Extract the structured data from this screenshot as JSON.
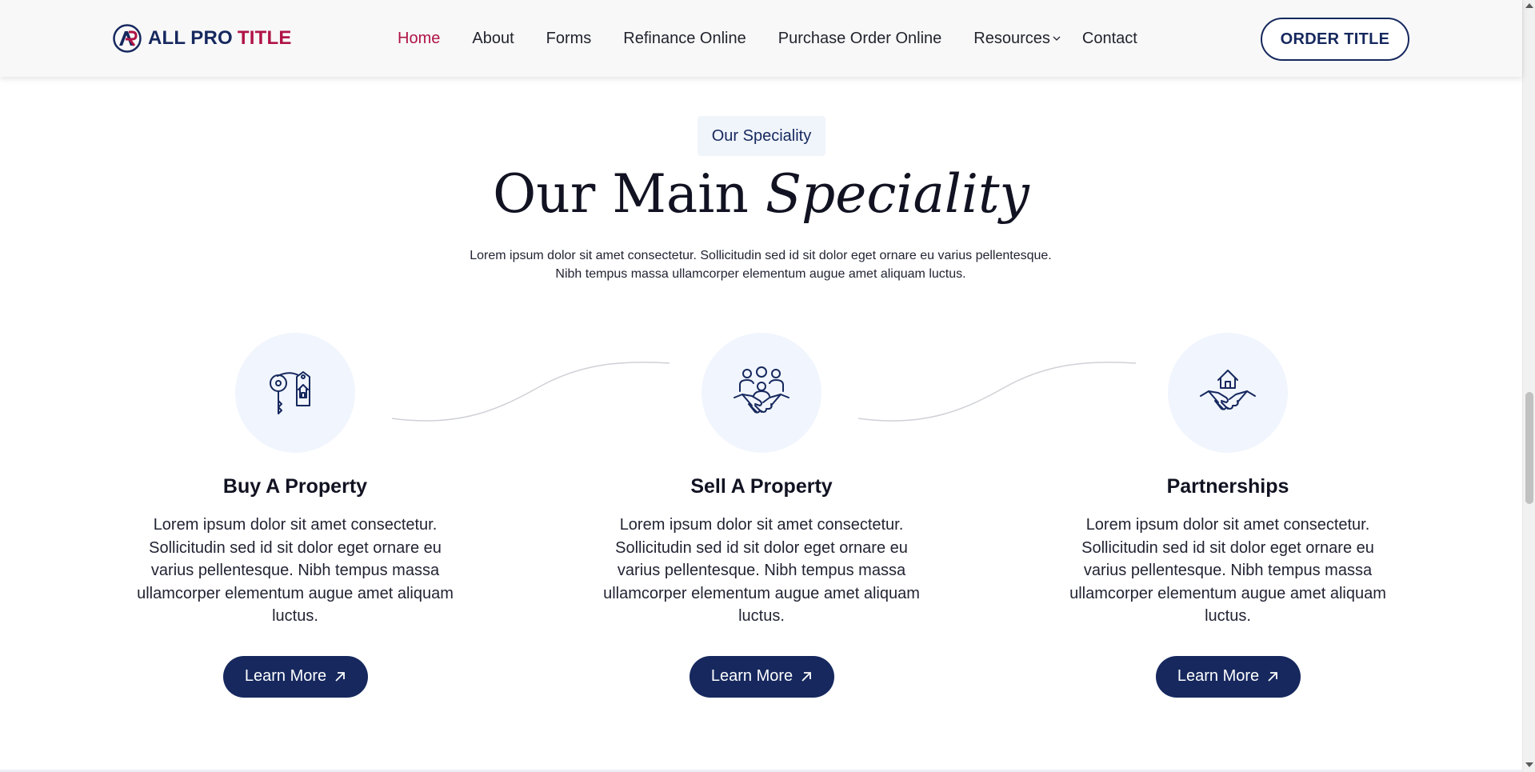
{
  "header": {
    "logo": {
      "mark_text": "AP",
      "word1": "ALL",
      "word2": "PRO",
      "word3": "TITLE"
    },
    "nav": [
      {
        "label": "Home",
        "active": true
      },
      {
        "label": "About"
      },
      {
        "label": "Forms"
      },
      {
        "label": "Refinance Online"
      },
      {
        "label": "Purchase Order Online"
      },
      {
        "label": "Resources",
        "has_dropdown": true
      },
      {
        "label": "Contact"
      }
    ],
    "cta_label": "ORDER TITLE"
  },
  "section": {
    "eyebrow": "Our Speciality",
    "title_plain": "Our Main",
    "title_emphasis": "Speciality",
    "intro_line1": "Lorem ipsum dolor sit amet consectetur. Sollicitudin sed id sit dolor eget ornare eu varius pellentesque.",
    "intro_line2": "Nibh tempus massa ullamcorper elementum augue amet aliquam luctus."
  },
  "cards": [
    {
      "icon": "key-house-tag-icon",
      "title": "Buy A Property",
      "text": "Lorem ipsum dolor sit amet consectetur. Sollicitudin sed id sit dolor eget ornare eu varius pellentesque. Nibh tempus massa ullamcorper elementum augue amet aliquam luctus.",
      "button": "Learn More"
    },
    {
      "icon": "people-handshake-icon",
      "title": "Sell A Property",
      "text": "Lorem ipsum dolor sit amet consectetur. Sollicitudin sed id sit dolor eget ornare eu varius pellentesque. Nibh tempus massa ullamcorper elementum augue amet aliquam luctus.",
      "button": "Learn More"
    },
    {
      "icon": "house-handshake-icon",
      "title": "Partnerships",
      "text": "Lorem ipsum dolor sit amet consectetur. Sollicitudin sed id sit dolor eget ornare eu varius pellentesque. Nibh tempus massa ullamcorper elementum augue amet aliquam luctus.",
      "button": "Learn More"
    }
  ],
  "colors": {
    "navy": "#16285e",
    "crimson": "#b01446",
    "icon_bg": "#f1f5fd",
    "eyebrow_bg": "#f0f4fb"
  }
}
